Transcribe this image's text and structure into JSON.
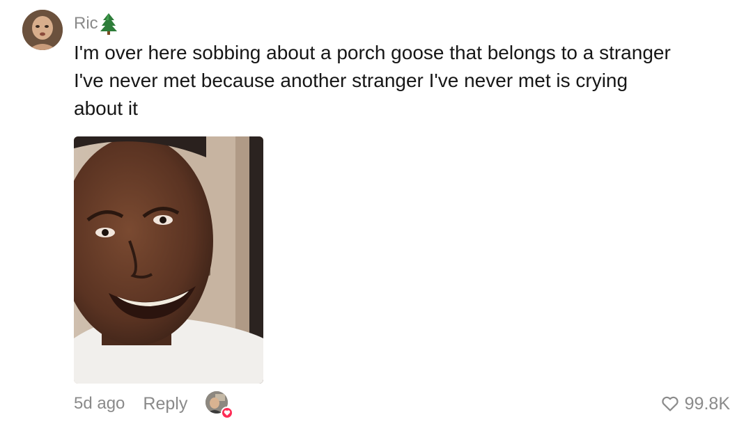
{
  "comment": {
    "username": "Ric",
    "username_emoji": "evergreen-tree",
    "text": "I'm over here sobbing about a porch goose that belongs to a stranger I've never met because another stranger I've never met is crying about it",
    "image_description": "reaction-photo-crying-man",
    "time": "5d ago",
    "reply_label": "Reply",
    "like_count": "99.8K",
    "creator_liked": true
  },
  "colors": {
    "text_primary": "#161616",
    "text_secondary": "#8a8a8a",
    "accent_like": "#fe2c55",
    "background": "#ffffff"
  }
}
